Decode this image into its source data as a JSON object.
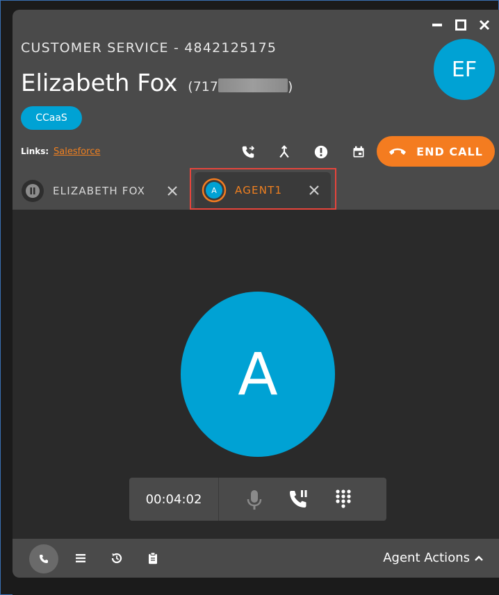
{
  "header": {
    "queue": "CUSTOMER SERVICE - 4842125175",
    "contact_name": "Elizabeth Fox",
    "contact_phone_visible": "(717",
    "contact_phone_end": ")",
    "avatar_initials": "EF",
    "tag": "CCaaS",
    "links_label": "Links:",
    "links_item": "Salesforce",
    "end_call_label": "END CALL"
  },
  "tabs": [
    {
      "label": "ELIZABETH FOX",
      "state": "on-hold"
    },
    {
      "label": "AGENT1",
      "avatar_initial": "A",
      "state": "active"
    }
  ],
  "main": {
    "avatar_initial": "A",
    "timer": "00:04:02"
  },
  "footer": {
    "agent_actions_label": "Agent Actions"
  },
  "colors": {
    "accent_blue": "#00a2d4",
    "accent_orange": "#f47c20",
    "highlight_red": "#e8453c"
  },
  "icons": [
    "minimize-icon",
    "maximize-icon",
    "close-icon",
    "transfer-call-icon",
    "merge-icon",
    "alert-icon",
    "calendar-icon",
    "phone-hangup-icon",
    "pause-icon",
    "mic-icon",
    "hold-call-icon",
    "dialpad-icon",
    "phone-icon",
    "list-icon",
    "history-icon",
    "clipboard-icon",
    "chevron-up-icon"
  ]
}
